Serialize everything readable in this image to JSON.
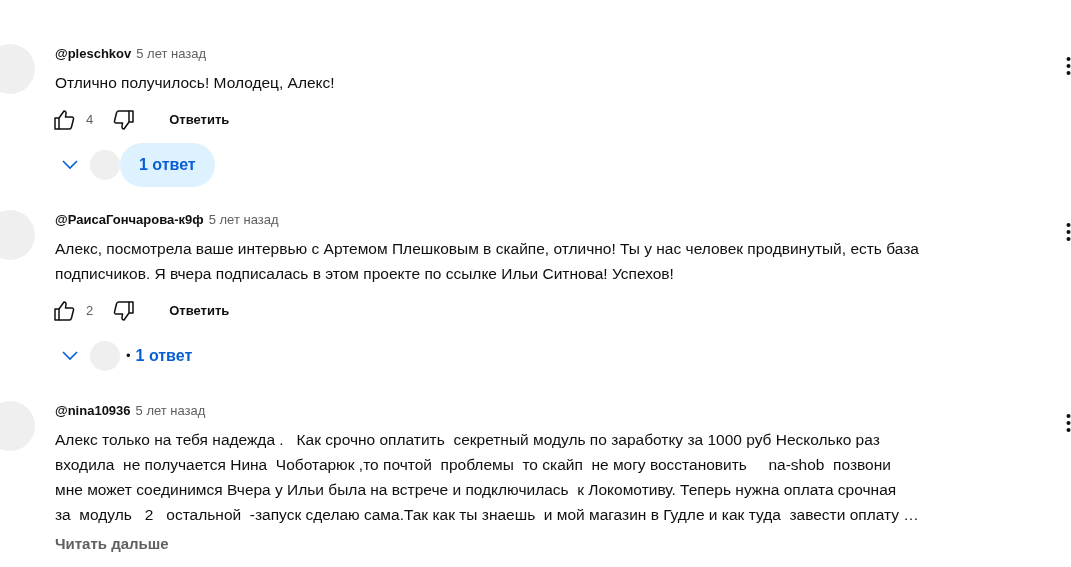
{
  "comments": [
    {
      "author": "@pleschkov",
      "time": "5 лет назад",
      "body": [
        "Отлично получилось! Молодец, Алекс!"
      ],
      "likes": "4",
      "reply_label": "Ответить",
      "replies": {
        "label": "1 ответ",
        "highlighted": true
      }
    },
    {
      "author": "@РаисаГончарова-к9ф",
      "time": "5 лет назад",
      "body": [
        "Алекс, посмотрела ваше интервью с Артемом Плешковым в скайпе, отлично! Ты у нас человек продвинутый, есть база",
        "подписчиков. Я вчера подписалась в этом проекте по ссылке Ильи Ситнова! Успехов!"
      ],
      "likes": "2",
      "reply_label": "Ответить",
      "replies": {
        "bullet": "•",
        "label": "1 ответ",
        "highlighted": false
      }
    },
    {
      "author": "@nina10936",
      "time": "5 лет назад",
      "body": [
        "Алекс только на тебя надежда .   Как срочно оплатить  секретный модуль по заработку за 1000 руб Несколько раз",
        "входила  не получается Нина  Чоботарюк ,то почтой  проблемы  то скайп  не могу восстановить     na-shob  позвони",
        "мне может соединимся Вчера у Ильи была на встрече и подключилась  к Локомотиву. Теперь нужна оплата срочная",
        "за  модуль   2   остальной  -запуск сделаю сама.Так как ты знаешь  и мой магазин в Гудле и как туда  завести оплату …"
      ],
      "read_more": "Читать дальше"
    }
  ]
}
